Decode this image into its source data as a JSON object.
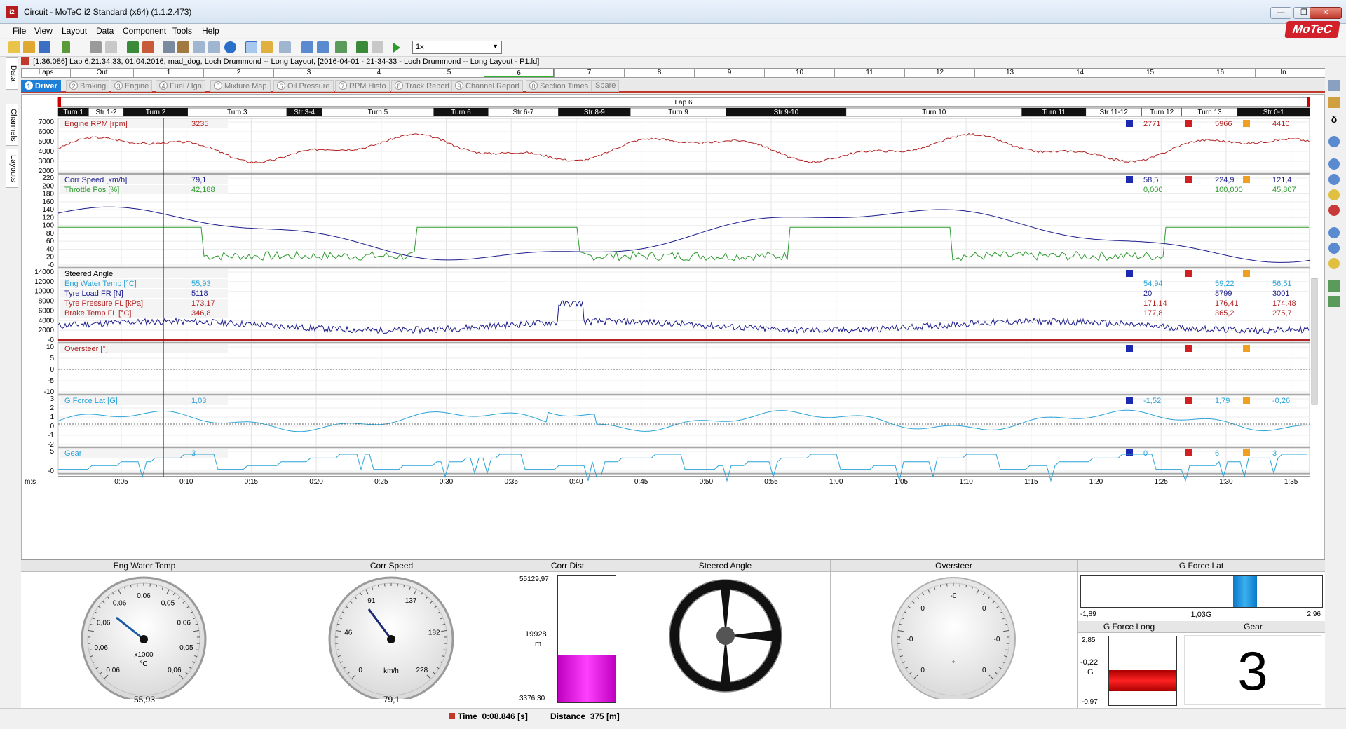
{
  "window": {
    "title": "Circuit - MoTeC i2 Standard (x64) (1.1.2.473)",
    "app_icon": "i2",
    "minimize": "—",
    "maximize": "❐",
    "close": "✕"
  },
  "menu": [
    "File",
    "View",
    "Layout",
    "Data",
    "Component",
    "Tools",
    "Help"
  ],
  "logo": "MoTeC",
  "toolbar": {
    "zoom": "1x"
  },
  "left_tabs": [
    "Data",
    "Channels",
    "Layouts"
  ],
  "info_line": "[1:36.086] Lap 6,21:34:33, 01.04.2016,  mad_dog, Loch Drummond -- Long Layout,  [2016-04-01 - 21-34-33 - Loch Drummond -- Long Layout - P1.ld]",
  "laps_row": [
    "Laps",
    "Out",
    "1",
    "2",
    "3",
    "4",
    "5",
    "6",
    "7",
    "8",
    "9",
    "10",
    "11",
    "12",
    "13",
    "14",
    "15",
    "16",
    "In"
  ],
  "worksheet_tabs": [
    {
      "num": "1",
      "label": "Driver"
    },
    {
      "num": "2",
      "label": "Braking"
    },
    {
      "num": "3",
      "label": "Engine"
    },
    {
      "num": "4",
      "label": "Fuel / Ign"
    },
    {
      "num": "5",
      "label": "Mixture Map"
    },
    {
      "num": "6",
      "label": "Oil Pressure"
    },
    {
      "num": "7",
      "label": "RPM Histo"
    },
    {
      "num": "8",
      "label": "Track Report"
    },
    {
      "num": "9",
      "label": "Channel Report"
    },
    {
      "num": "0",
      "label": "Section Times"
    },
    {
      "num": "",
      "label": "Spare"
    }
  ],
  "lap_banner": "Lap 6",
  "sections": [
    "Turn 1",
    "Str 1-2",
    "Turn 2",
    "Turn 3",
    "Str 3-4",
    "Turn 5",
    "Turn 6",
    "Str 6-7",
    "Str 8-9",
    "Turn 9",
    "Str 9-10",
    "Turn 10",
    "Turn 11",
    "Str 11-12",
    "Turn 12",
    "Turn 13",
    "Str 0-1"
  ],
  "x_axis": {
    "unit": "m:s",
    "ticks": [
      "0:05",
      "0:10",
      "0:15",
      "0:20",
      "0:25",
      "0:30",
      "0:35",
      "0:40",
      "0:45",
      "0:50",
      "0:55",
      "1:00",
      "1:05",
      "1:10",
      "1:15",
      "1:20",
      "1:25",
      "1:30",
      "1:35"
    ]
  },
  "panes": [
    {
      "y_ticks": [
        "7000",
        "6000",
        "5000",
        "4000",
        "3000",
        "2000"
      ],
      "channels": [
        {
          "name": "Engine RPM [rpm]",
          "value": "3235",
          "color": "#b22222",
          "min": "2771",
          "max": "5966",
          "avg": "4410"
        }
      ]
    },
    {
      "y_ticks": [
        "220",
        "200",
        "180",
        "160",
        "140",
        "120",
        "100",
        "80",
        "60",
        "40",
        "20",
        "-0"
      ],
      "channels": [
        {
          "name": "Corr Speed [km/h]",
          "value": "79,1",
          "color": "#1c1c8c",
          "min": "58,5",
          "max": "224,9",
          "avg": "121,4"
        },
        {
          "name": "Throttle Pos [%]",
          "value": "42,188",
          "color": "#2e9a2e",
          "min": "0,000",
          "max": "100,000",
          "avg": "45,807"
        }
      ]
    },
    {
      "y_ticks": [
        "14000",
        "12000",
        "10000",
        "8000",
        "6000",
        "4000",
        "2000",
        "-0"
      ],
      "channels": [
        {
          "name": "Steered Angle",
          "value": "",
          "color": "#000000",
          "min": "",
          "max": "",
          "avg": ""
        },
        {
          "name": "Eng Water Temp [°C]",
          "value": "55,93",
          "color": "#29a3d6",
          "min": "54,94",
          "max": "59,22",
          "avg": "56,51"
        },
        {
          "name": "Tyre Load FR [N]",
          "value": "5118",
          "color": "#1c1c8c",
          "min": "20",
          "max": "8799",
          "avg": "3001"
        },
        {
          "name": "Tyre Pressure FL [kPa]",
          "value": "173,17",
          "color": "#b22222",
          "min": "171,14",
          "max": "176,41",
          "avg": "174,48"
        },
        {
          "name": "Brake Temp FL [°C]",
          "value": "346,8",
          "color": "#b22222",
          "min": "177,8",
          "max": "365,2",
          "avg": "275,7"
        }
      ]
    },
    {
      "y_ticks": [
        "10",
        "5",
        "0",
        "-5",
        "-10"
      ],
      "channels": [
        {
          "name": "Oversteer [°]",
          "value": "",
          "color": "#b22222",
          "min": "",
          "max": "",
          "avg": ""
        }
      ]
    },
    {
      "y_ticks": [
        "3",
        "2",
        "1",
        "0",
        "-1",
        "-2"
      ],
      "channels": [
        {
          "name": "G Force Lat [G]",
          "value": "1,03",
          "color": "#29a3d6",
          "min": "-1,52",
          "max": "1,79",
          "avg": "-0,26"
        }
      ]
    },
    {
      "y_ticks": [
        "5",
        "-0"
      ],
      "channels": [
        {
          "name": "Gear",
          "value": "3",
          "color": "#29a3d6",
          "min": "0",
          "max": "6",
          "avg": "3"
        }
      ]
    }
  ],
  "gauges": {
    "water": {
      "title": "Eng Water Temp",
      "ticks": [
        "0,06",
        "0,06",
        "0,06",
        "0,06",
        "0,06",
        "0,05",
        "0,06",
        "0,05",
        "0,06"
      ],
      "unit1": "x1000",
      "unit2": "°C",
      "value": "55,93"
    },
    "speed": {
      "title": "Corr Speed",
      "ticks": [
        "0",
        "46",
        "91",
        "137",
        "182",
        "228"
      ],
      "unit": "km/h",
      "value": "79,1"
    },
    "dist": {
      "title": "Corr Dist",
      "max": "55129,97",
      "current": "19928",
      "unit": "m",
      "min": "3376,30",
      "fill_fraction": 0.37
    },
    "steer": {
      "title": "Steered Angle"
    },
    "oversteer": {
      "title": "Oversteer",
      "ticks": [
        "0",
        "-0",
        "0",
        "-0",
        "0",
        "-0",
        "0"
      ],
      "unit": "°"
    },
    "glat": {
      "title": "G Force Lat",
      "min": "-1,89",
      "value": "1,03G",
      "max": "2,96",
      "fraction": 0.68
    },
    "glong": {
      "title": "G Force Long",
      "max": "2,85",
      "value": "-0,22",
      "unit": "G",
      "min": "-0,97"
    },
    "gear": {
      "title": "Gear",
      "value": "3"
    }
  },
  "status": {
    "time_label": "Time",
    "time_value": "0:08.846 [s]",
    "distance_label": "Distance",
    "distance_value": "375 [m]"
  }
}
